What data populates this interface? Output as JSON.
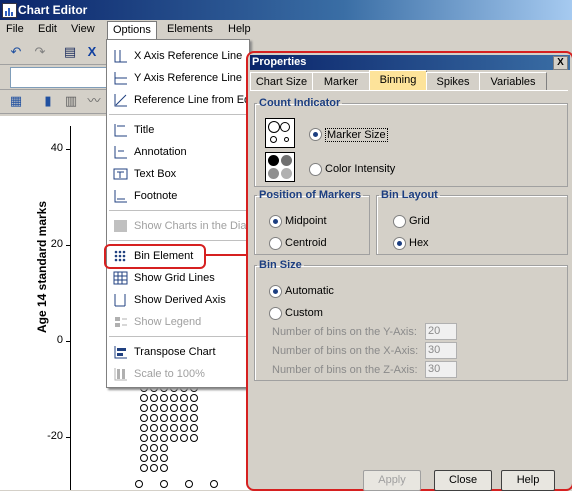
{
  "window": {
    "title": "Chart Editor"
  },
  "menubar": {
    "items": [
      "File",
      "Edit",
      "View",
      "Options",
      "Elements",
      "Help"
    ],
    "active": "Options"
  },
  "chart": {
    "ylabel": "Age 14 standard marks",
    "yticks": [
      "40",
      "20",
      "0",
      "-20"
    ]
  },
  "options_menu": {
    "items": [
      {
        "label": "X Axis Reference Line",
        "icon": "x-axis-reference-icon",
        "enabled": true
      },
      {
        "label": "Y Axis Reference Line",
        "icon": "y-axis-reference-icon",
        "enabled": true
      },
      {
        "label": "Reference Line from Eq",
        "icon": "reference-line-equation-icon",
        "enabled": true
      },
      {
        "label": "Title",
        "icon": "title-icon",
        "enabled": true
      },
      {
        "label": "Annotation",
        "icon": "annotation-icon",
        "enabled": true
      },
      {
        "label": "Text Box",
        "icon": "text-box-icon",
        "enabled": true
      },
      {
        "label": "Footnote",
        "icon": "footnote-icon",
        "enabled": true
      },
      {
        "label": "Show Charts in the Dia",
        "icon": "show-charts-icon",
        "enabled": false
      },
      {
        "label": "Bin Element",
        "icon": "bin-element-icon",
        "enabled": true
      },
      {
        "label": "Show Grid Lines",
        "icon": "grid-lines-icon",
        "enabled": true
      },
      {
        "label": "Show Derived Axis",
        "icon": "derived-axis-icon",
        "enabled": true
      },
      {
        "label": "Show Legend",
        "icon": "legend-icon",
        "enabled": false
      },
      {
        "label": "Transpose Chart",
        "icon": "transpose-icon",
        "enabled": true
      },
      {
        "label": "Scale to 100%",
        "icon": "scale-icon",
        "enabled": false
      }
    ]
  },
  "properties": {
    "title": "Properties",
    "close": "X",
    "tabs": [
      "Chart Size",
      "Marker",
      "Binning",
      "Spikes",
      "Variables"
    ],
    "active_tab": "Binning",
    "count_indicator": {
      "legend": "Count Indicator",
      "marker_size": "Marker Size",
      "color_intensity": "Color Intensity",
      "selected": "Marker Size"
    },
    "position_of_markers": {
      "legend": "Position of Markers",
      "midpoint": "Midpoint",
      "centroid": "Centroid",
      "selected": "Midpoint"
    },
    "bin_layout": {
      "legend": "Bin Layout",
      "grid": "Grid",
      "hex": "Hex",
      "selected": "Hex"
    },
    "bin_size": {
      "legend": "Bin Size",
      "automatic": "Automatic",
      "custom": "Custom",
      "selected": "Automatic",
      "y_label": "Number of bins on the Y-Axis:",
      "y_value": "20",
      "x_label": "Number of bins on the X-Axis:",
      "x_value": "30",
      "z_label": "Number of bins on the Z-Axis:",
      "z_value": "30"
    },
    "buttons": {
      "apply": "Apply",
      "close": "Close",
      "help": "Help"
    }
  },
  "colors": {
    "highlight": "#d62020",
    "active_tab": "#fde39a",
    "title_bar": "#0a246a"
  }
}
